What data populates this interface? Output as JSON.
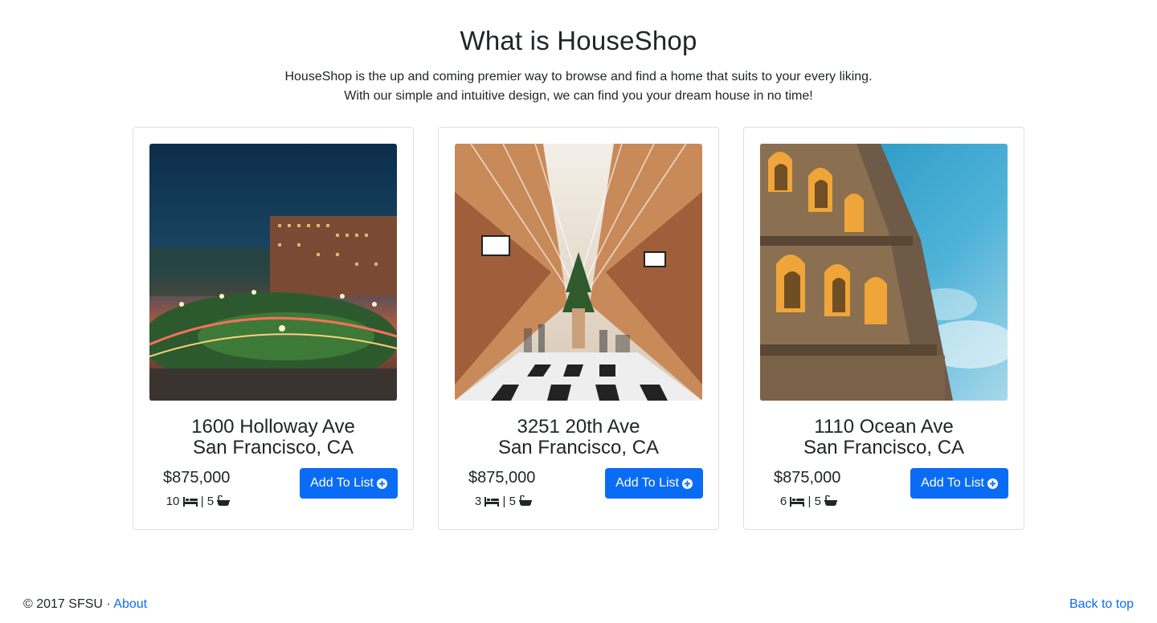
{
  "hero": {
    "title": "What is HouseShop",
    "line1": "HouseShop is the up and coming premier way to browse and find a home that suits to your every liking.",
    "line2": "With our simple and intuitive design, we can find you your dream house in no time!"
  },
  "listings": [
    {
      "street": "1600 Holloway Ave",
      "city": "San Francisco, CA",
      "price": "$875,000",
      "beds": "10",
      "baths": "5",
      "button_label": "Add To List",
      "image": "campus-at-night-photo"
    },
    {
      "street": "3251 20th Ave",
      "city": "San Francisco, CA",
      "price": "$875,000",
      "beds": "3",
      "baths": "5",
      "button_label": "Add To List",
      "image": "shopping-arcade-photo"
    },
    {
      "street": "1110 Ocean Ave",
      "city": "San Francisco, CA",
      "price": "$875,000",
      "beds": "6",
      "baths": "5",
      "button_label": "Add To List",
      "image": "colosseum-photo"
    }
  ],
  "icons": {
    "bed": "bed-icon",
    "bath": "bath-icon",
    "add": "plus-circle-icon"
  },
  "footer": {
    "copyright": "© 2017 SFSU ·",
    "about_link": "About",
    "back_to_top": "Back to top"
  },
  "colors": {
    "primary": "#0a6cf5",
    "text": "#212529",
    "card_border": "#dfdfdf"
  }
}
